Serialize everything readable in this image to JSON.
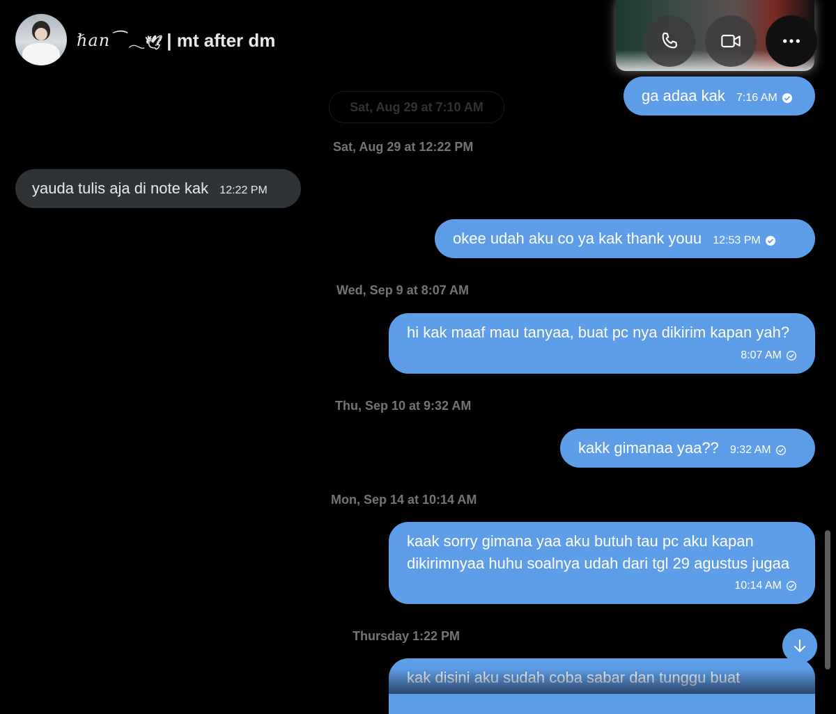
{
  "header": {
    "name_script": "ℏ𝑎𝑛⁀",
    "name_flower": "𓂃🕊",
    "name_suffix": "| mt after dm",
    "call_label": "phone-icon",
    "video_label": "video-camera-icon",
    "more_label": "more-horizontal-icon"
  },
  "dates": {
    "d0": "Sat, Aug 29 at 7:10 AM",
    "d1": "Sat, Aug 29 at 12:22 PM",
    "d2": "Wed, Sep 9 at 8:07 AM",
    "d3": "Thu, Sep 10 at 9:32 AM",
    "d4": "Mon, Sep 14 at 10:14 AM",
    "d5": "Thursday 1:22 PM"
  },
  "messages": [
    {
      "text": "ga adaa kak",
      "time": "7:16 AM",
      "status": "read"
    },
    {
      "text": "yauda tulis aja di note kak",
      "time": "12:22 PM"
    },
    {
      "text": "okee udah aku co ya kak thank youu",
      "time": "12:53 PM",
      "status": "read"
    },
    {
      "text": "hi kak maaf mau tanyaa, buat pc nya dikirim kapan yah?",
      "time": "8:07 AM",
      "status": "sent"
    },
    {
      "text": "kakk gimanaa yaa??",
      "time": "9:32 AM",
      "status": "sent"
    },
    {
      "text": "kaak sorry gimana yaa aku butuh tau pc aku kapan dikirimnyaa huhu soalnya udah dari tgl 29 agustus jugaa",
      "time": "10:14 AM",
      "status": "sent"
    },
    {
      "text": "kak disini aku sudah coba sabar dan tunggu buat"
    }
  ],
  "colors": {
    "outgoing": "#5e9ee8",
    "incoming": "#2f3336",
    "background": "#000000"
  }
}
